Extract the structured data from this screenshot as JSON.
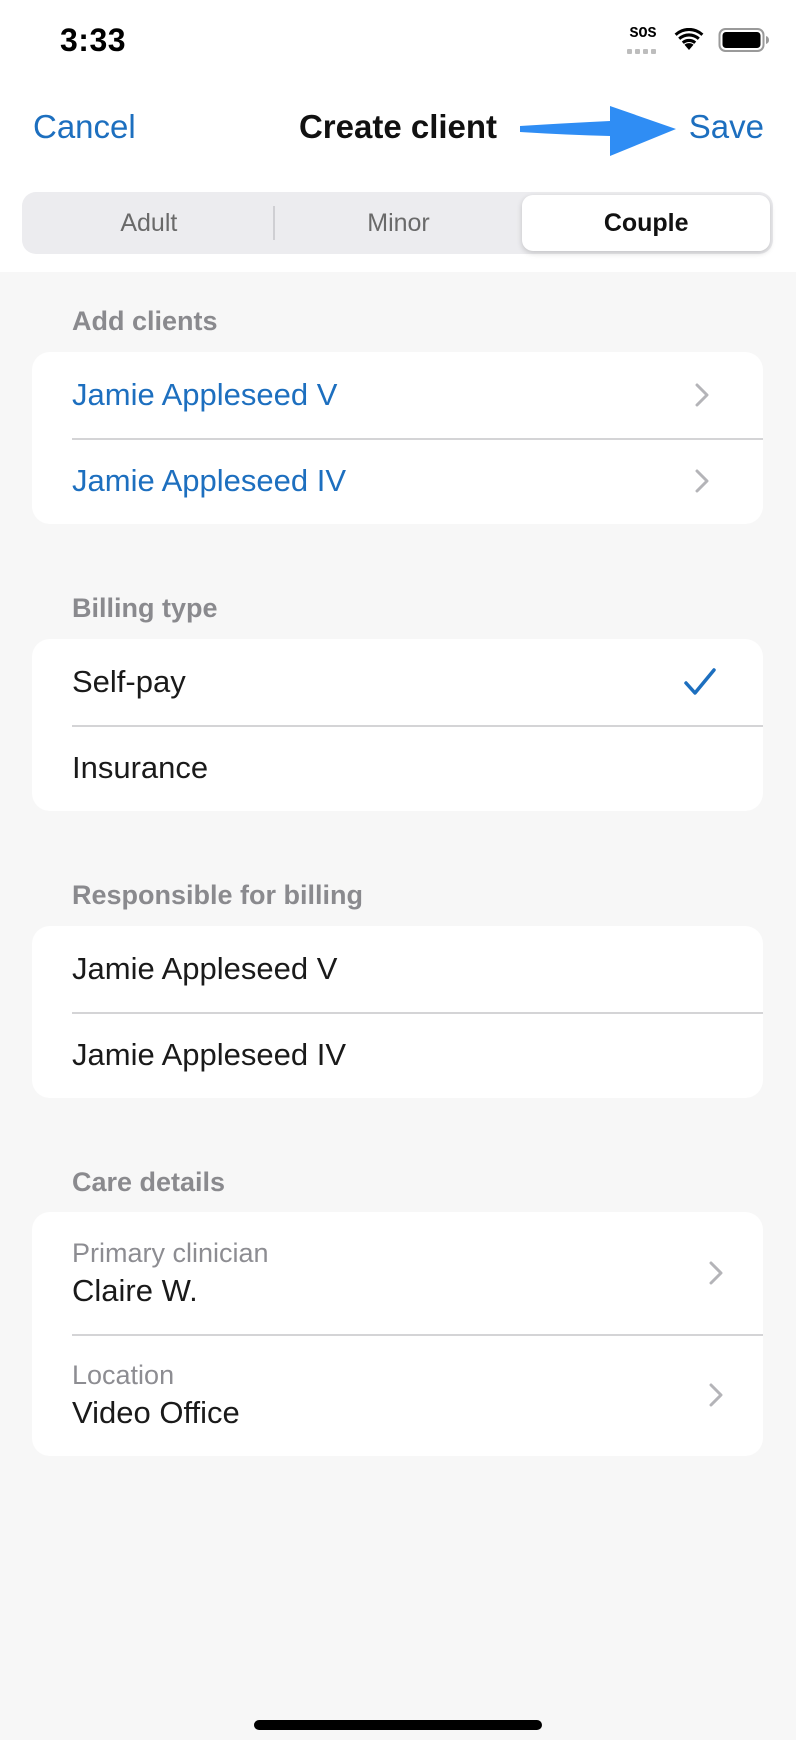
{
  "status_bar": {
    "time": "3:33",
    "sos_label": "SOS"
  },
  "nav": {
    "cancel_label": "Cancel",
    "title": "Create client",
    "save_label": "Save"
  },
  "segments": {
    "items": [
      {
        "label": "Adult",
        "selected": false
      },
      {
        "label": "Minor",
        "selected": false
      },
      {
        "label": "Couple",
        "selected": true
      }
    ]
  },
  "add_clients": {
    "header": "Add clients",
    "items": [
      {
        "label": "Jamie Appleseed V"
      },
      {
        "label": "Jamie Appleseed IV"
      }
    ]
  },
  "billing_type": {
    "header": "Billing type",
    "options": [
      {
        "label": "Self-pay",
        "checked": true
      },
      {
        "label": "Insurance",
        "checked": false
      }
    ]
  },
  "responsible_billing": {
    "header": "Responsible for billing",
    "items": [
      {
        "label": "Jamie Appleseed V"
      },
      {
        "label": "Jamie Appleseed IV"
      }
    ]
  },
  "care_details": {
    "header": "Care details",
    "primary_clinician": {
      "label": "Primary clinician",
      "value": "Claire W."
    },
    "location": {
      "label": "Location",
      "value": "Video Office"
    }
  },
  "colors": {
    "accent": "#1d6fbf",
    "annotation_arrow": "#2f8df4",
    "background": "#f7f7f7",
    "secondary_text": "#8a8a8e"
  },
  "icons": {
    "chevron": "chevron-right-icon",
    "check": "checkmark-icon",
    "wifi": "wifi-icon",
    "battery": "battery-icon",
    "annotation": "arrow-right-icon"
  }
}
